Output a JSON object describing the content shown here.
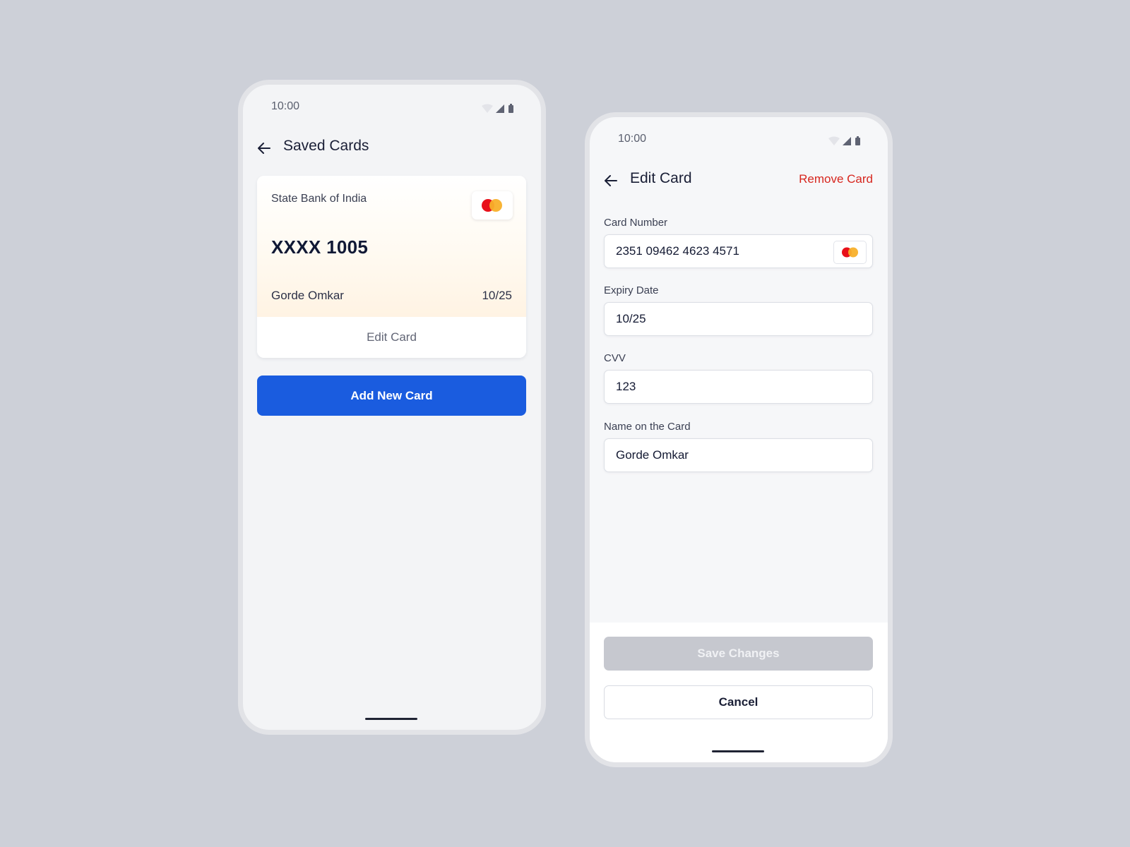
{
  "screen_saved": {
    "status_time": "10:00",
    "title": "Saved Cards",
    "card": {
      "bank": "State Bank of India",
      "masked_number": "XXXX 1005",
      "holder": "Gorde Omkar",
      "expiry": "10/25",
      "brand_icon": "mastercard-icon",
      "edit_label": "Edit Card"
    },
    "add_button_label": "Add New Card"
  },
  "screen_edit": {
    "status_time": "10:00",
    "title": "Edit Card",
    "remove_label": "Remove Card",
    "fields": {
      "card_number": {
        "label": "Card Number",
        "value": "2351 09462 4623 4571"
      },
      "expiry": {
        "label": "Expiry Date",
        "value": "10/25"
      },
      "cvv": {
        "label": "CVV",
        "value": "123"
      },
      "name": {
        "label": "Name on the Card",
        "value": "Gorde Omkar"
      }
    },
    "save_label": "Save Changes",
    "cancel_label": "Cancel"
  },
  "colors": {
    "primary": "#1a5cdf",
    "danger": "#d7261e",
    "disabled": "#c6c8cf",
    "background": "#cdd0d8"
  }
}
